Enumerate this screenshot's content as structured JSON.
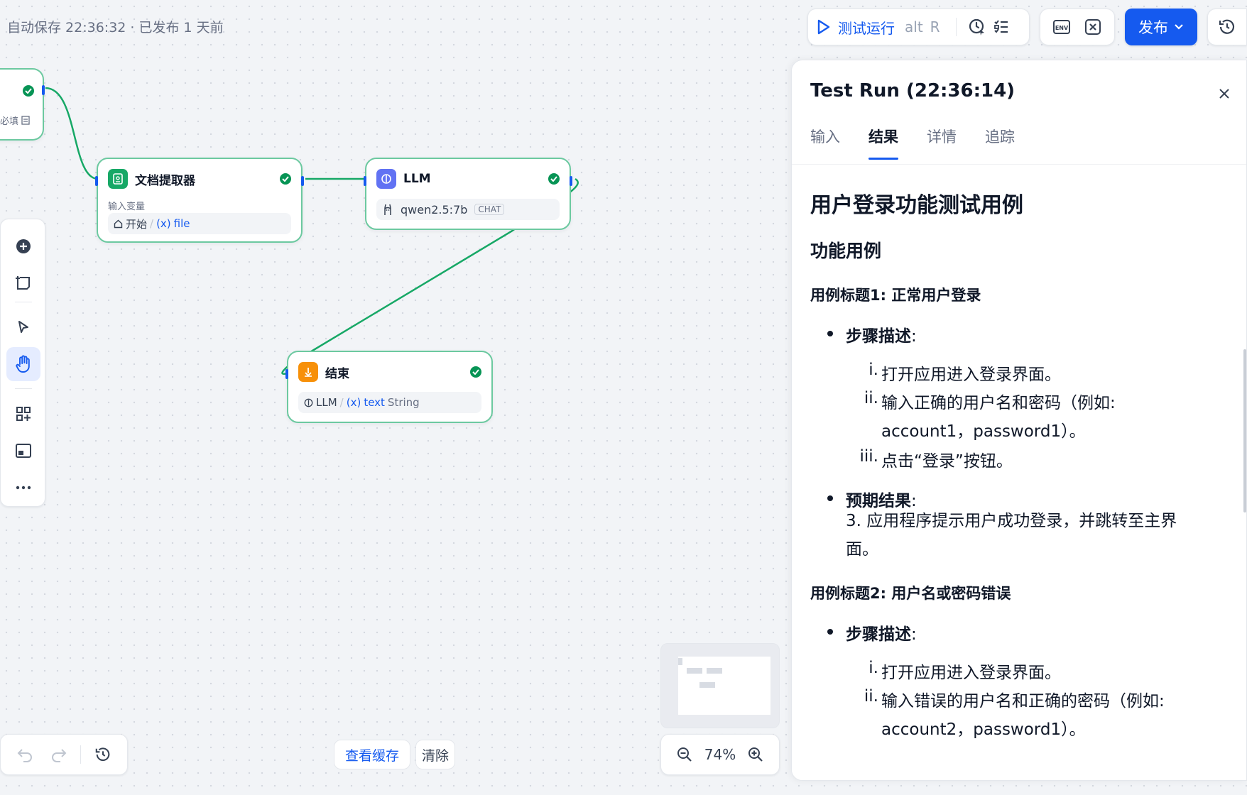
{
  "header": {
    "autosave_status": "自动保存 22:36:32 · 已发布 1 天前",
    "run_label": "测试运行",
    "shortcut_key_1": "alt",
    "shortcut_key_2": "R",
    "publish_label": "发布",
    "env_icon": "env-icon",
    "var_icon": "variable-icon"
  },
  "nodes": {
    "start": {
      "required_label": "必填"
    },
    "doc_extractor": {
      "title": "文档提取器",
      "input_label": "输入变量",
      "source_node": "开始",
      "var_symbol": "(x)",
      "var_name": "file"
    },
    "llm": {
      "title": "LLM",
      "model": "qwen2.5:7b",
      "badge": "CHAT"
    },
    "end": {
      "title": "结束",
      "source_node": "LLM",
      "var_symbol": "(x)",
      "var_name": "text",
      "var_type": "String"
    }
  },
  "bottom": {
    "view_cache": "查看缓存",
    "clear": "清除",
    "zoom": "74%"
  },
  "panel": {
    "title": "Test Run (22:36:14)",
    "tabs": [
      {
        "label": "输入"
      },
      {
        "label": "结果"
      },
      {
        "label": "详情"
      },
      {
        "label": "追踪"
      }
    ],
    "active_tab": "结果",
    "result": {
      "h1": "用户登录功能测试用例",
      "h2": "功能用例",
      "case1_title": "用例标题1: 正常用户登录",
      "steps_label": "步骤描述",
      "steps_colon": ":",
      "case1_steps": [
        {
          "num": "i.",
          "text": "打开应用进入登录界面。"
        },
        {
          "num": "ii.",
          "text": "输入正确的用户名和密码（例如:"
        },
        {
          "num": "",
          "text": "account1，password1）。"
        },
        {
          "num": "iii.",
          "text": "点击“登录”按钮。"
        }
      ],
      "expected_label": "预期结果",
      "expected_colon": ":",
      "expected_line1": "3. 应用程序提示用户成功登录，并跳转至主界",
      "expected_line2": "面。",
      "case2_title": "用例标题2: 用户名或密码错误",
      "case2_steps": [
        {
          "num": "i.",
          "text": "打开应用进入登录界面。"
        },
        {
          "num": "ii.",
          "text": "输入错误的用户名和正确的密码（例如:"
        },
        {
          "num": "",
          "text": "account2，password1）。"
        }
      ]
    }
  },
  "colors": {
    "accent": "#155aef",
    "success": "#079455",
    "edge": "#17a866",
    "node_border": "#6cc9a0"
  }
}
